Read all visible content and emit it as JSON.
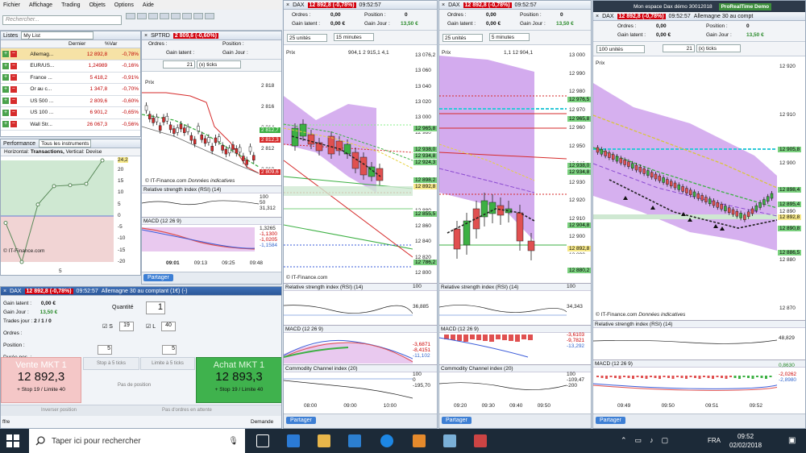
{
  "menu": [
    "Fichier",
    "Affichage",
    "Trading",
    "Objets",
    "Options",
    "Aide"
  ],
  "search_placeholder": "Rechercher...",
  "watchlist": {
    "tab1": "Listes",
    "tab2": "My List",
    "col_last": "Dernier",
    "col_var": "%Var",
    "rows": [
      {
        "name": "Allemag...",
        "last": "12 892,8",
        "var": "-0,78%"
      },
      {
        "name": "EUR/US...",
        "last": "1,24989",
        "var": "-0,16%"
      },
      {
        "name": "France ...",
        "last": "5 418,2",
        "var": "-0,91%"
      },
      {
        "name": "Or au c...",
        "last": "1 347,8",
        "var": "-0,70%"
      },
      {
        "name": "US 500 ...",
        "last": "2 809,6",
        "var": "-0,60%"
      },
      {
        "name": "US 100 ...",
        "last": "6 901,2",
        "var": "-0,65%"
      },
      {
        "name": "Wall Str...",
        "last": "26 067,3",
        "var": "-0,56%"
      }
    ]
  },
  "perf": {
    "title": "Performance",
    "mode": "Tous les instruments",
    "horizontal": "Horizontal:",
    "htype": "Transactions,",
    "vertical": "Vertical: Devise",
    "yticks": [
      "24,2",
      "20",
      "15",
      "10",
      "5",
      "0",
      "-5",
      "-10",
      "-15",
      "-20"
    ],
    "xtick": "5",
    "credit": "© IT-Finance.com",
    "points": [
      -3,
      -20,
      5,
      13,
      13.4,
      14,
      24.2
    ]
  },
  "sptrd": {
    "title": "SPTRD",
    "badge": "2 809,6 (-0,60%)",
    "ordres": "Ordres :",
    "position": "Position :",
    "gain_latent": "Gain latent :",
    "gain_jour": "Gain Jour :",
    "ticks": "21",
    "tick_unit": "(x) ticks",
    "prix": "Prix",
    "yticks": [
      "2 818",
      "2 816",
      "2 814",
      "2 812",
      "2 810"
    ],
    "badges": [
      "2 812,7",
      "2 812,3",
      "2 809,6"
    ],
    "credit": "© IT-Finance.com",
    "credit2": "Données indicatives",
    "rsi": "Relative strength index (RSI) (14)",
    "rsi_vals": [
      "100",
      "50",
      "31,312",
      "0"
    ],
    "macd": "MACD (12 26 9)",
    "macd_vals": [
      "1,3265",
      "-1,1300",
      "-1,0205",
      "-1,1584"
    ],
    "xticks": [
      "09:01",
      "09:13",
      "09:25",
      "09:48"
    ],
    "partager": "Partager"
  },
  "dax1": {
    "title": "DAX",
    "badge": "12 892,8 (-0,78%)",
    "time": "09:52:57",
    "ordres": "Ordres :",
    "ordres_v": "0,00",
    "position": "Position :",
    "position_v": "0",
    "gain_latent": "Gain latent :",
    "gain_latent_v": "0,00 €",
    "gain_jour": "Gain Jour :",
    "gain_jour_v": "13,50 €",
    "units": "25 unités",
    "tf": "15 minutes",
    "prix": "Prix",
    "ohlc": "904,1 2 915,1 4,1",
    "yticks": [
      "13 076,2",
      "13 060",
      "13 040",
      "13 020",
      "13 000",
      "12 980",
      "12 960",
      "12 940",
      "12 920",
      "12 900",
      "12 880",
      "12 860",
      "12 840",
      "12 820",
      "12 800"
    ],
    "labels": [
      "mS1",
      "mS2",
      "S1"
    ],
    "badges": [
      "12 965,8",
      "12 938,0",
      "12 934,8",
      "12 924,3",
      "12 898,2",
      "12 892,8",
      "7m01s",
      "12 855,5",
      "12 786,2"
    ],
    "low": "1@12 863,9",
    "low_b": "1,8",
    "credit": "© IT-Finance.com",
    "rsi": "Relative strength index (RSI) (14)",
    "rsi_vals": [
      "100",
      "36,885",
      "0"
    ],
    "macd": "MACD (12 26 9)",
    "macd_vals": [
      "-3,6871",
      "-8,4151",
      "-11,102"
    ],
    "cci": "Commodity Channel index (20)",
    "cci_vals": [
      "100",
      "0",
      "-100",
      "-195,70"
    ],
    "xticks": [
      "08:00",
      "09:00",
      "10:00"
    ],
    "partager": "Partager"
  },
  "dax2": {
    "title": "DAX",
    "badge": "12 892,8 (-0,78%)",
    "time": "09:52:57",
    "ordres": "Ordres :",
    "ordres_v": "0,00",
    "position": "Position :",
    "position_v": "0",
    "gain_latent": "Gain latent :",
    "gain_latent_v": "0,00 €",
    "gain_jour": "Gain Jour :",
    "gain_jour_v": "13,50 €",
    "units": "25 unités",
    "tf": "5 minutes",
    "prix": "Prix",
    "ohlc": "1,1 12 904,1",
    "yticks": [
      "13 000",
      "12 990",
      "12 980",
      "12 970",
      "12 960",
      "12 950",
      "12 940",
      "12 930",
      "12 920",
      "12 910",
      "12 900",
      "12 890",
      "12 880"
    ],
    "labels": [
      "mS1"
    ],
    "badges": [
      "12 976,5",
      "12 965,8",
      "12 938,0",
      "12 934,8",
      "12 904,8",
      "12 892,8",
      "2m01s",
      "12 880,2"
    ],
    "low": "1@12 915,1",
    "low_b": "1@12 891,8",
    "credit": "© IT-Finance.com",
    "rsi": "Relative strength index (RSI) (14)",
    "rsi_vals": [
      "100",
      "34,343",
      "0"
    ],
    "macd": "MACD (12 26 9)",
    "macd_vals": [
      "-3,6103",
      "-9,7821",
      "-13,292"
    ],
    "cci": "Commodity Channel index (20)",
    "cci_vals": [
      "100",
      "0",
      "-109,47",
      "-200"
    ],
    "xticks": [
      "09:20",
      "09:30",
      "09:40",
      "09:50"
    ],
    "partager": "Partager"
  },
  "dax3": {
    "title": "DAX",
    "badge": "12 892,8 (-0,78%)",
    "time": "09:52:57",
    "name": "Allemagne 30 au compt",
    "window": "Mon espace Dax démo 30012018",
    "brand": "ProRealTime",
    "demo": "Demo",
    "ordres": "Ordres :",
    "ordres_v": "0,00",
    "position": "Position :",
    "position_v": "0",
    "gain_latent": "Gain latent :",
    "gain_latent_v": "0,00 €",
    "gain_jour": "Gain Jour :",
    "gain_jour_v": "13,50 €",
    "units": "100 unités",
    "ticks": "21",
    "tick_unit": "(x) ticks",
    "prix": "Prix",
    "yticks": [
      "12 920",
      "12 910",
      "12 900",
      "12 890",
      "12 880",
      "12 870"
    ],
    "badges": [
      "12 905,8",
      "12 898,4",
      "12 895,4",
      "12 892,8",
      "12 890,8",
      "12 886,5"
    ],
    "low": "1@12 891,8",
    "credit": "© IT-Finance.com",
    "credit2": "Données indicatives",
    "rsi": "Relative strength index (RSI) (14)",
    "rsi_vals": [
      "48,829"
    ],
    "macd": "MACD (12 26 9)",
    "macd_vals": [
      "0,8630",
      "-2,0262",
      "-2,8980"
    ],
    "xticks": [
      "09:49",
      "09:50",
      "09:51",
      "09:52"
    ],
    "partager": "Partager"
  },
  "order": {
    "title": "DAX",
    "badge": "12 892,8 (-0,78%)",
    "time": "09:52:57",
    "name": "Allemagne 30 au comptant (1€) (-)",
    "gain_latent": "Gain latent :",
    "gain_latent_v": "0,00 €",
    "gain_jour": "Gain Jour :",
    "gain_jour_v": "13,50 €",
    "trades": "Trades jour :",
    "trades_v": "2 / 1 / 0",
    "ordres": "Ordres :",
    "position": "Position :",
    "duree": "Durée pos. :",
    "quantite": "Quantité",
    "quantite_v": "1",
    "s": "S",
    "s_v": "19",
    "l": "L",
    "l_v": "40",
    "v5a": "5",
    "v5b": "5",
    "stop5": "Stop à 5 ticks",
    "limit5": "Limite à 5 ticks",
    "pas_pos": "Pas de position",
    "vente": "Vente MKT 1",
    "vente_p": "12 892,3",
    "vente_sub": "+ Stop 19 / Limite 40",
    "achat": "Achat MKT 1",
    "achat_p": "12 893,3",
    "achat_sub": "+ Stop 19 / Limite 40",
    "inverser": "Inverser position",
    "pas_ordres": "Pas d'ordres en attente",
    "statut": "ffre",
    "demande": "Demande"
  },
  "taskbar": {
    "search": "Taper ici pour rechercher",
    "lang": "FRA",
    "time": "09:52",
    "date": "02/02/2018"
  },
  "colors": {
    "bull": "#3cb043",
    "bear": "#e05050",
    "cloud": "#b36ae0",
    "accent": "#3d7fd4"
  }
}
